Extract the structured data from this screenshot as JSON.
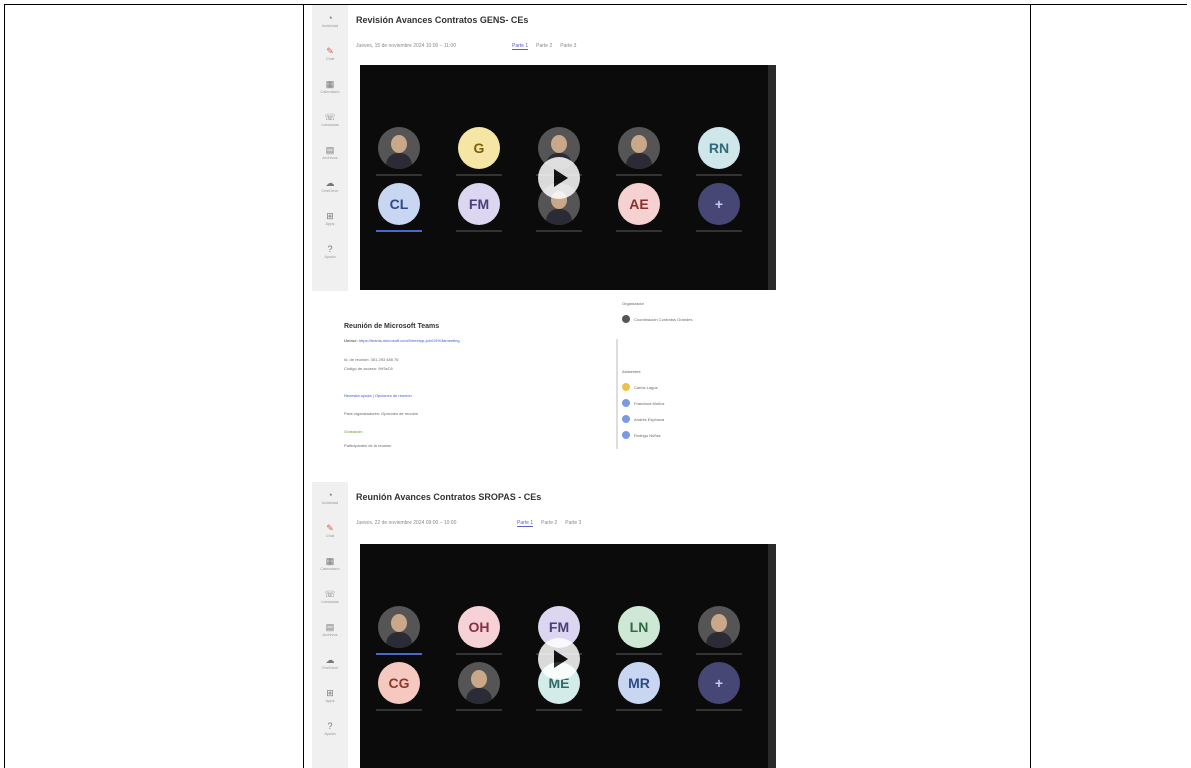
{
  "meeting1": {
    "title": "Revisión Avances Contratos GENS- CEs",
    "datetime": "Jueves, 15 de noviembre 2024 10:00 – 11:00",
    "tabs": [
      "Parte 1",
      "Parte 2",
      "Parte 3"
    ],
    "rail": [
      "Actividad",
      "Chat",
      "Calendario",
      "Llamadas",
      "Archivos",
      "OneDrive",
      "Apps",
      "Ayuda"
    ],
    "tiles_row1": [
      {
        "kind": "photo",
        "initials": ""
      },
      {
        "kind": "initials",
        "initials": "G",
        "bg": "#f6e6a6",
        "fg": "#7a5e10"
      },
      {
        "kind": "photo",
        "initials": ""
      },
      {
        "kind": "photo",
        "initials": ""
      },
      {
        "kind": "initials",
        "initials": "RN",
        "bg": "#cfe6ea",
        "fg": "#2f6b78"
      }
    ],
    "tiles_row2": [
      {
        "kind": "initials",
        "initials": "CL",
        "bg": "#c8d6f2",
        "fg": "#314a86"
      },
      {
        "kind": "initials",
        "initials": "FM",
        "bg": "#ddd6f0",
        "fg": "#4b3f7a"
      },
      {
        "kind": "photo",
        "initials": ""
      },
      {
        "kind": "initials",
        "initials": "AE",
        "bg": "#f6d1d1",
        "fg": "#8a2f2f"
      },
      {
        "kind": "more",
        "initials": "+",
        "bg": "#464775",
        "fg": "#c8c9f0"
      }
    ],
    "details": {
      "heading": "Reunión de Microsoft Teams",
      "join_label": "Unirse:",
      "join_link": "https://teams.microsoft.com/l/meetup-join/19%3ameeting",
      "meeting_id": "Id. de reunión: 351 293 485 76",
      "passcode": "Código de acceso: 9H3zC6",
      "line1": "Necesita ayuda | Opciones de reunión",
      "line2": "Para organizadores: Opciones de reunión",
      "line3": "Grabación",
      "line4": "Participantes de la reunión"
    },
    "participants_panel": {
      "organizer_label": "Organizador",
      "organizer": "Coordinación Contratos Grandes",
      "section": "Asistentes",
      "people": [
        "Carlos Lagos",
        "Francisca Muñoz",
        "Andrés Espinoza",
        "Rodrigo Núñez"
      ]
    }
  },
  "meeting2": {
    "title": "Reunión Avances Contratos SROPAS - CEs",
    "datetime": "Jueves, 22 de noviembre 2024 09:00 – 10:00",
    "tabs": [
      "Parte 1",
      "Parte 2",
      "Parte 3"
    ],
    "rail": [
      "Actividad",
      "Chat",
      "Calendario",
      "Llamadas",
      "Archivos",
      "OneDrive",
      "Apps",
      "Ayuda"
    ],
    "tiles_row1": [
      {
        "kind": "photo",
        "initials": ""
      },
      {
        "kind": "initials",
        "initials": "OH",
        "bg": "#f6d1d6",
        "fg": "#8a2f3f"
      },
      {
        "kind": "initials",
        "initials": "FM",
        "bg": "#ddd6f0",
        "fg": "#4b3f7a"
      },
      {
        "kind": "initials",
        "initials": "LN",
        "bg": "#cfe8d6",
        "fg": "#2f6b45"
      },
      {
        "kind": "photo",
        "initials": ""
      }
    ],
    "tiles_row2": [
      {
        "kind": "initials",
        "initials": "CG",
        "bg": "#f6c9c0",
        "fg": "#8a3a2f"
      },
      {
        "kind": "photo",
        "initials": ""
      },
      {
        "kind": "initials",
        "initials": "ME",
        "bg": "#d3ecea",
        "fg": "#2f6b66"
      },
      {
        "kind": "initials",
        "initials": "MR",
        "bg": "#c8d6f2",
        "fg": "#314a86"
      },
      {
        "kind": "more",
        "initials": "+",
        "bg": "#464775",
        "fg": "#c8c9f0"
      }
    ]
  }
}
